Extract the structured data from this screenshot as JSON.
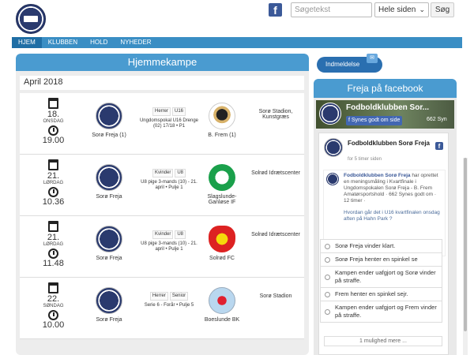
{
  "header": {
    "search_placeholder": "Søgetekst",
    "scope_value": "Hele siden",
    "search_button": "Søg"
  },
  "nav": [
    "HJEM",
    "KLUBBEN",
    "HOLD",
    "NYHEDER"
  ],
  "main": {
    "title": "Hjemmekampe",
    "month": "April 2018",
    "matches": [
      {
        "day": "18.",
        "weekday": "ONSDAG",
        "time": "19.00",
        "home": "Sorø Freja (1)",
        "tag1": "Herrer",
        "tag2": "U16",
        "info": "Ungdomspokal U16 Drenge (02) 17/18 • P1",
        "away": "B. Frem (1)",
        "venue": "Sorø Stadion, Kunstgræs"
      },
      {
        "day": "21.",
        "weekday": "LØRDAG",
        "time": "10.36",
        "home": "Sorø Freja",
        "tag1": "Kvinder",
        "tag2": "U8",
        "info": "U8 pige 3-mands (10) - 21. april • Pulje 1",
        "away": "Slagslunde-Ganløse IF",
        "venue": "Solrød Idrætscenter"
      },
      {
        "day": "21.",
        "weekday": "LØRDAG",
        "time": "11.48",
        "home": "Sorø Freja",
        "tag1": "Kvinder",
        "tag2": "U8",
        "info": "U8 pige 3-mands (10) - 21. april • Pulje 1",
        "away": "Solrød FC",
        "venue": "Solrød Idrætscenter"
      },
      {
        "day": "22.",
        "weekday": "SØNDAG",
        "time": "10.00",
        "home": "Sorø Freja",
        "tag1": "Herrer",
        "tag2": "Senior",
        "info": "Serie 6 - Forår • Pulje 5",
        "away": "Boeslunde BK",
        "venue": "Sorø Stadion"
      }
    ]
  },
  "side": {
    "membership": "Indmeldelse",
    "facebook_title": "Freja på facebook",
    "page_name": "Fodboldklubben Sor...",
    "like_button": "Synes godt om side",
    "likes": "662 Syn",
    "post_name": "Fodboldklubben Sorø Freja",
    "post_time": "for 5 timer siden",
    "shared_author": "Fodboldklubben Sorø Freja",
    "shared_text": "har oprettet en meningsmåling i Kvartfinale i Ungdomspokalen Sorø Freja - B. Frem",
    "shared_meta": "Amatørsportshold · 662 Synes godt om · 12 timer ·",
    "question": "Hvordan går det i U16 kvartfinalen onsdag aften på Hahn Park ?",
    "poll": [
      "Sorø Freja vinder klart.",
      "Sorø Freja henter en spinkel se",
      "Kampen ender uafgjort og Sorø vinder på straffe.",
      "Frem henter en spinkel sejr.",
      "Kampen ender uafgjort og Frem vinder på straffe."
    ],
    "more": "1 mulighed mere ..."
  }
}
